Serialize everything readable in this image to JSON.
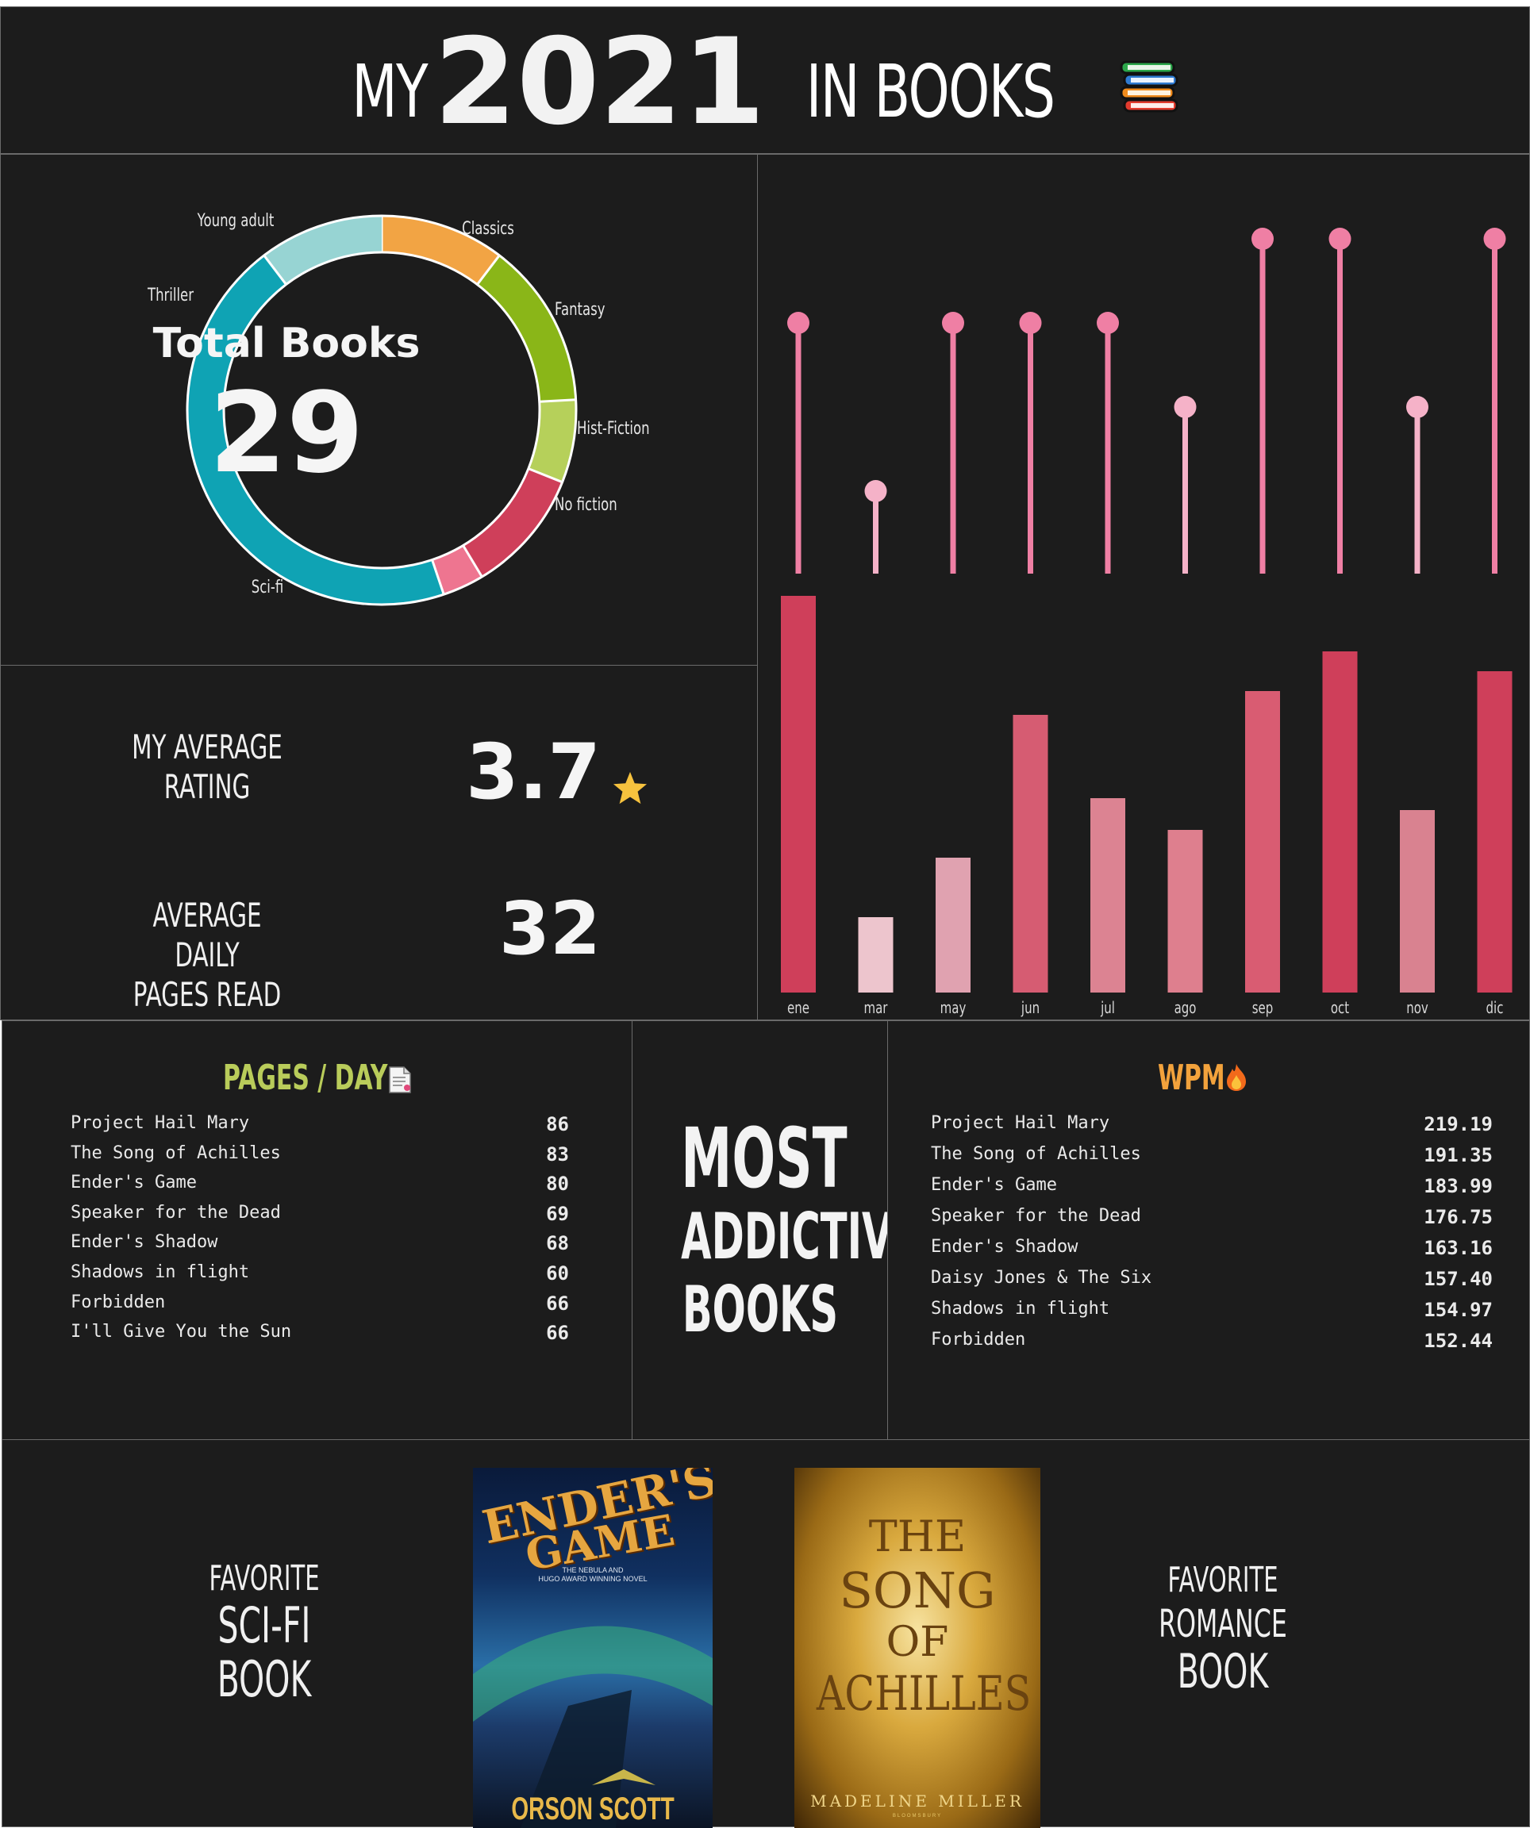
{
  "header": {
    "title_prefix": "MY",
    "year": "2021",
    "title_suffix": "IN BOOKS",
    "icon": "books-stack-icon"
  },
  "donut": {
    "center_title": "Total Books",
    "center_value": "29",
    "legend": [
      "Young adult",
      "Classics",
      "Fantasy",
      "Hist-Fiction",
      "No fiction",
      "Sci-fi",
      "Thriller"
    ]
  },
  "stats": {
    "rating_label_1": "MY AVERAGE",
    "rating_label_2": "RATING",
    "rating_value": "3.7",
    "rating_icon": "star-icon",
    "pages_label_1": "AVERAGE DAILY",
    "pages_label_2": "PAGES READ",
    "pages_value": "32"
  },
  "chart_data": [
    {
      "type": "donut",
      "title": "Total Books",
      "categories": [
        "Young adult",
        "Classics",
        "Fantasy",
        "Hist-Fiction",
        "No fiction",
        "Sci-fi",
        "Thriller"
      ],
      "values": [
        3,
        4,
        2,
        3,
        1,
        13,
        3
      ],
      "colors": [
        "#f2a444",
        "#8ab618",
        "#b6d05a",
        "#cf3f5a",
        "#ee7590",
        "#0fa3b4",
        "#97d4d3"
      ]
    },
    {
      "type": "lollipop",
      "categories": [
        "ene",
        "mar",
        "may",
        "jun",
        "jul",
        "ago",
        "sep",
        "oct",
        "nov",
        "dic"
      ],
      "values": [
        3,
        1,
        3,
        3,
        3,
        2,
        4,
        4,
        2,
        4
      ],
      "color": "#ef7fa4"
    },
    {
      "type": "bar",
      "categories": [
        "ene",
        "mar",
        "may",
        "jun",
        "jul",
        "ago",
        "sep",
        "oct",
        "nov",
        "dic"
      ],
      "values": [
        100,
        19,
        34,
        70,
        49,
        41,
        76,
        86,
        46,
        81
      ],
      "colors": [
        "#cf3f5a",
        "#edc5cd",
        "#e0a2b0",
        "#d65c72",
        "#dc8392",
        "#de7f8e",
        "#d95c72",
        "#cf3f5a",
        "#d98290",
        "#cf3f5a"
      ]
    }
  ],
  "pages_day": {
    "title": "PAGES / DAY",
    "icon": "document-icon",
    "rows": [
      {
        "name": "Project Hail Mary",
        "value": "86"
      },
      {
        "name": "The Song of Achilles",
        "value": "83"
      },
      {
        "name": "Ender's Game",
        "value": "80"
      },
      {
        "name": "Speaker for the Dead",
        "value": "69"
      },
      {
        "name": "Ender's Shadow",
        "value": "68"
      },
      {
        "name": "Shadows in flight",
        "value": "60"
      },
      {
        "name": "Forbidden",
        "value": "66"
      },
      {
        "name": "I'll Give You the Sun",
        "value": "66"
      }
    ]
  },
  "most_addictive": {
    "line1": "MOST",
    "line2": "ADDICTIVE",
    "line3": "BOOKS"
  },
  "wpm": {
    "title": "WPM",
    "icon": "fire-icon",
    "rows": [
      {
        "name": "Project Hail Mary",
        "value": "219.19"
      },
      {
        "name": "The Song of Achilles",
        "value": "191.35"
      },
      {
        "name": "Ender's Game",
        "value": "183.99"
      },
      {
        "name": "Speaker for the Dead",
        "value": "176.75"
      },
      {
        "name": "Ender's Shadow",
        "value": "163.16"
      },
      {
        "name": "Daisy Jones & The Six",
        "value": "157.40"
      },
      {
        "name": "Shadows in flight",
        "value": "154.97"
      },
      {
        "name": "Forbidden",
        "value": "152.44"
      }
    ]
  },
  "favorites": {
    "scifi_1": "FAVORITE",
    "scifi_2": "SCI-FI",
    "scifi_3": "BOOK",
    "romance_1": "FAVORITE",
    "romance_2": "ROMANCE",
    "romance_3": "BOOK",
    "cover1": {
      "title_1": "ENDER'S",
      "title_2": "GAME",
      "tagline_1": "THE NEBULA AND",
      "tagline_2": "HUGO AWARD WINNING NOVEL",
      "author": "ORSON SCOTT CARD"
    },
    "cover2": {
      "title_1": "THE",
      "title_2": "SONG",
      "title_3": "OF",
      "title_4": "ACHILLES",
      "author": "MADELINE MILLER",
      "publisher": "BLOOMSBURY"
    }
  }
}
